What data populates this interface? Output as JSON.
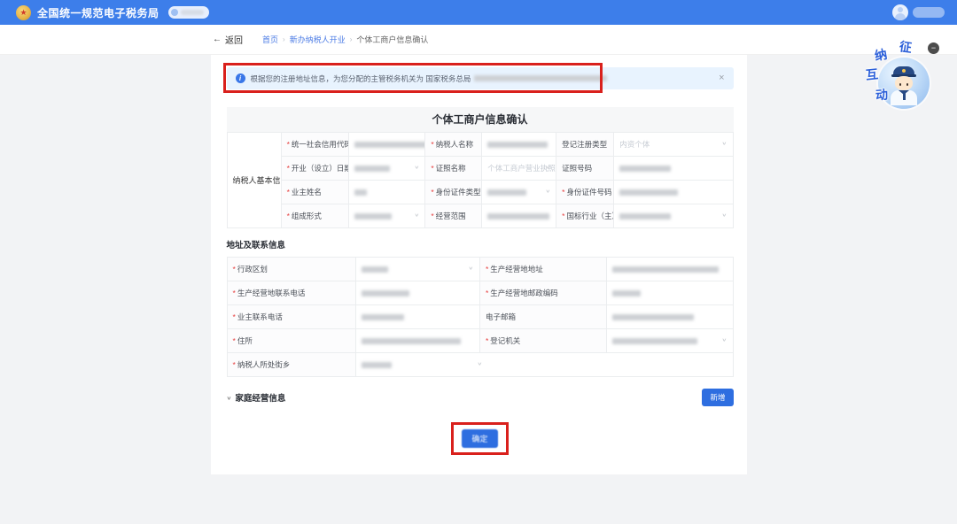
{
  "icons": {
    "star": "★",
    "back": "←",
    "sep": "›",
    "chevron": "∨",
    "close": "×",
    "info": "i",
    "minus": "−",
    "collapse": "∨"
  },
  "required_marker": "*",
  "topbar": {
    "title": "全国统一规范电子税务局"
  },
  "nav": {
    "back": "返回",
    "crumbs": [
      "首页",
      "新办纳税人开业",
      "个体工商户信息确认"
    ]
  },
  "alert": {
    "text": "根据您的注册地址信息，为您分配的主管税务机关为 国家税务总局"
  },
  "form": {
    "title": "个体工商户信息确认",
    "basic": {
      "group": "纳税人基本信息",
      "rows": [
        [
          {
            "label": "统一社会信用代码",
            "required": true,
            "redacted": true
          },
          {
            "label": "纳税人名称",
            "required": true,
            "redacted": true
          },
          {
            "label": "登记注册类型",
            "required": false,
            "control": "select",
            "value": "内资个体"
          }
        ],
        [
          {
            "label": "开业（设立）日期",
            "required": true,
            "control": "select",
            "redacted": true
          },
          {
            "label": "证照名称",
            "required": true,
            "control": "select",
            "value": "个体工商户营业执照"
          },
          {
            "label": "证照号码",
            "required": false,
            "redacted": true
          }
        ],
        [
          {
            "label": "业主姓名",
            "required": true,
            "redacted": true
          },
          {
            "label": "身份证件类型",
            "required": true,
            "control": "select",
            "redacted": true
          },
          {
            "label": "身份证件号码",
            "required": true,
            "redacted": true
          }
        ],
        [
          {
            "label": "组成形式",
            "required": true,
            "control": "select",
            "redacted": true
          },
          {
            "label": "经营范围",
            "required": true,
            "redacted": true
          },
          {
            "label": "国标行业（主）",
            "required": true,
            "control": "select",
            "redacted": true
          }
        ]
      ]
    },
    "address": {
      "section_title": "地址及联系信息",
      "rows": [
        [
          {
            "label": "行政区划",
            "required": true,
            "control": "select",
            "redacted": true
          },
          {
            "label": "生产经营地地址",
            "required": true,
            "redacted": true
          }
        ],
        [
          {
            "label": "生产经营地联系电话",
            "required": true,
            "redacted": true
          },
          {
            "label": "生产经营地邮政编码",
            "required": true,
            "redacted": true
          }
        ],
        [
          {
            "label": "业主联系电话",
            "required": true,
            "redacted": true
          },
          {
            "label": "电子邮箱",
            "required": false,
            "redacted": true
          }
        ],
        [
          {
            "label": "住所",
            "required": true,
            "redacted": true
          },
          {
            "label": "登记机关",
            "required": true,
            "control": "select",
            "redacted": true
          }
        ],
        [
          {
            "label": "纳税人所处街乡",
            "required": true,
            "control": "select",
            "redacted": true
          }
        ]
      ]
    },
    "family": {
      "section_title": "家庭经营信息",
      "add_button": "新增"
    },
    "confirm_button": "确定"
  },
  "mascot": {
    "name": "征纳互动",
    "chars": [
      "纳",
      "征",
      "互",
      "动"
    ]
  }
}
